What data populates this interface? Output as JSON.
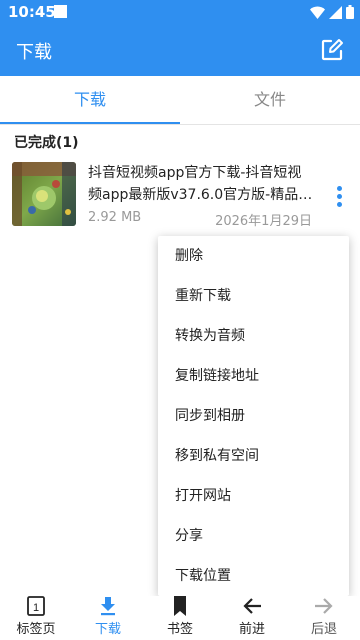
{
  "status_bar": {
    "time": "10:45"
  },
  "app_bar": {
    "title": "下载",
    "edit_icon": "edit-icon"
  },
  "tabs": [
    {
      "label": "下载",
      "active": true
    },
    {
      "label": "文件",
      "active": false
    }
  ],
  "section": {
    "header": "已完成(1)"
  },
  "download_item": {
    "title": "抖音短视频app官方下载-抖音短视频app最新版v37.6.0官方版-精品下...",
    "size": "2.92 MB",
    "date": "2026年1月29日"
  },
  "context_menu": {
    "items": [
      {
        "label": "删除"
      },
      {
        "label": "重新下载"
      },
      {
        "label": "转换为音频"
      },
      {
        "label": "复制链接地址"
      },
      {
        "label": "同步到相册"
      },
      {
        "label": "移到私有空间"
      },
      {
        "label": "打开网站"
      },
      {
        "label": "分享"
      },
      {
        "label": "下载位置"
      }
    ]
  },
  "bottom_nav": {
    "items": [
      {
        "label": "标签页",
        "icon": "tabs-count-icon",
        "badge": "1"
      },
      {
        "label": "下载",
        "icon": "download-icon"
      },
      {
        "label": "书签",
        "icon": "bookmark-icon"
      },
      {
        "label": "前进",
        "icon": "arrow-left-icon"
      },
      {
        "label": "后退",
        "icon": "arrow-right-icon"
      }
    ]
  },
  "colors": {
    "accent": "#2f8ff0"
  }
}
